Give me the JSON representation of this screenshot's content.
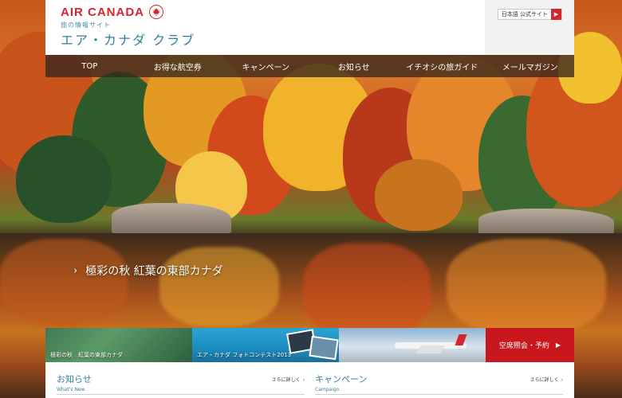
{
  "header": {
    "brand": "AIR CANADA",
    "subtitle": "旅の情報サイト",
    "club_title": "エア・カナダ クラブ",
    "japanese_site_label": "日本語 公式サイト",
    "japanese_site_arrow": "▶"
  },
  "nav": {
    "items": [
      {
        "label": "TOP"
      },
      {
        "label": "お得な航空券"
      },
      {
        "label": "キャンペーン"
      },
      {
        "label": "お知らせ"
      },
      {
        "label": "イチオシの旅ガイド"
      },
      {
        "label": "メールマガジン"
      }
    ]
  },
  "hero": {
    "chevron": "›",
    "caption": "極彩の秋 紅葉の東部カナダ"
  },
  "banners": {
    "items": [
      {
        "label": "極彩の秋　紅葉の東部カナダ"
      },
      {
        "label": "エア・カナダ フォトコンテスト2013"
      },
      {
        "label": ""
      }
    ],
    "reserve_label": "空席照会・予約",
    "reserve_chevron": "▶"
  },
  "sections": {
    "news": {
      "title": "お知らせ",
      "subtitle_en": "What's New",
      "more": "さらに詳しく",
      "more_chevron": "›"
    },
    "campaign": {
      "title": "キャンペーン",
      "subtitle_en": "Campaign",
      "more": "さらに詳しく",
      "more_chevron": "›"
    }
  },
  "colors": {
    "brand_red": "#d22630",
    "accent_teal": "#2f7f9a",
    "nav_bg": "#37281c"
  },
  "icons": {
    "logo": "maple-leaf-icon",
    "external": "arrow-right-icon"
  }
}
